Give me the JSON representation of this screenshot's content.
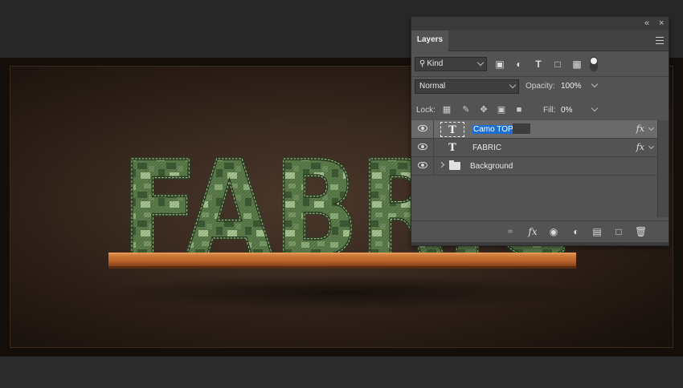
{
  "canvas": {
    "artwork_text": "FABRIC",
    "colors": {
      "background_center": "#4a372b",
      "background_edge": "#160f0b",
      "letter_camo_base": "#5c7d4b",
      "letter_camo_light": "#8fb07a",
      "letter_camo_dark": "#3e5a34",
      "shelf_wood": "#c06a2c"
    }
  },
  "panel": {
    "tab_label": "Layers",
    "collapse_icon": "double-chevron-icon",
    "close_icon": "close-icon",
    "menu_icon": "panel-menu-icon",
    "filter": {
      "kind_label": "Kind",
      "icons": [
        "pixel-filter-icon",
        "adjustment-filter-icon",
        "type-filter-icon",
        "shape-filter-icon",
        "smart-object-filter-icon",
        "filter-toggle-icon"
      ]
    },
    "blend_mode": "Normal",
    "opacity_label": "Opacity:",
    "opacity_value": "100%",
    "lock_label": "Lock:",
    "fill_label": "Fill:",
    "fill_value": "0%",
    "layers": [
      {
        "name": "Camo TOP",
        "type": "text",
        "selected": true,
        "editing": true,
        "has_fx": true,
        "visible": true
      },
      {
        "name": "FABRIC",
        "type": "text",
        "selected": false,
        "editing": false,
        "has_fx": true,
        "visible": true
      },
      {
        "name": "Background",
        "type": "group",
        "selected": false,
        "editing": false,
        "has_fx": false,
        "visible": true
      }
    ],
    "fx_label": "fx",
    "bottom_icons": [
      "link-layers-icon",
      "add-layer-style-icon",
      "add-mask-icon",
      "adjustment-layer-icon",
      "new-group-icon",
      "new-layer-icon",
      "delete-layer-icon"
    ]
  }
}
